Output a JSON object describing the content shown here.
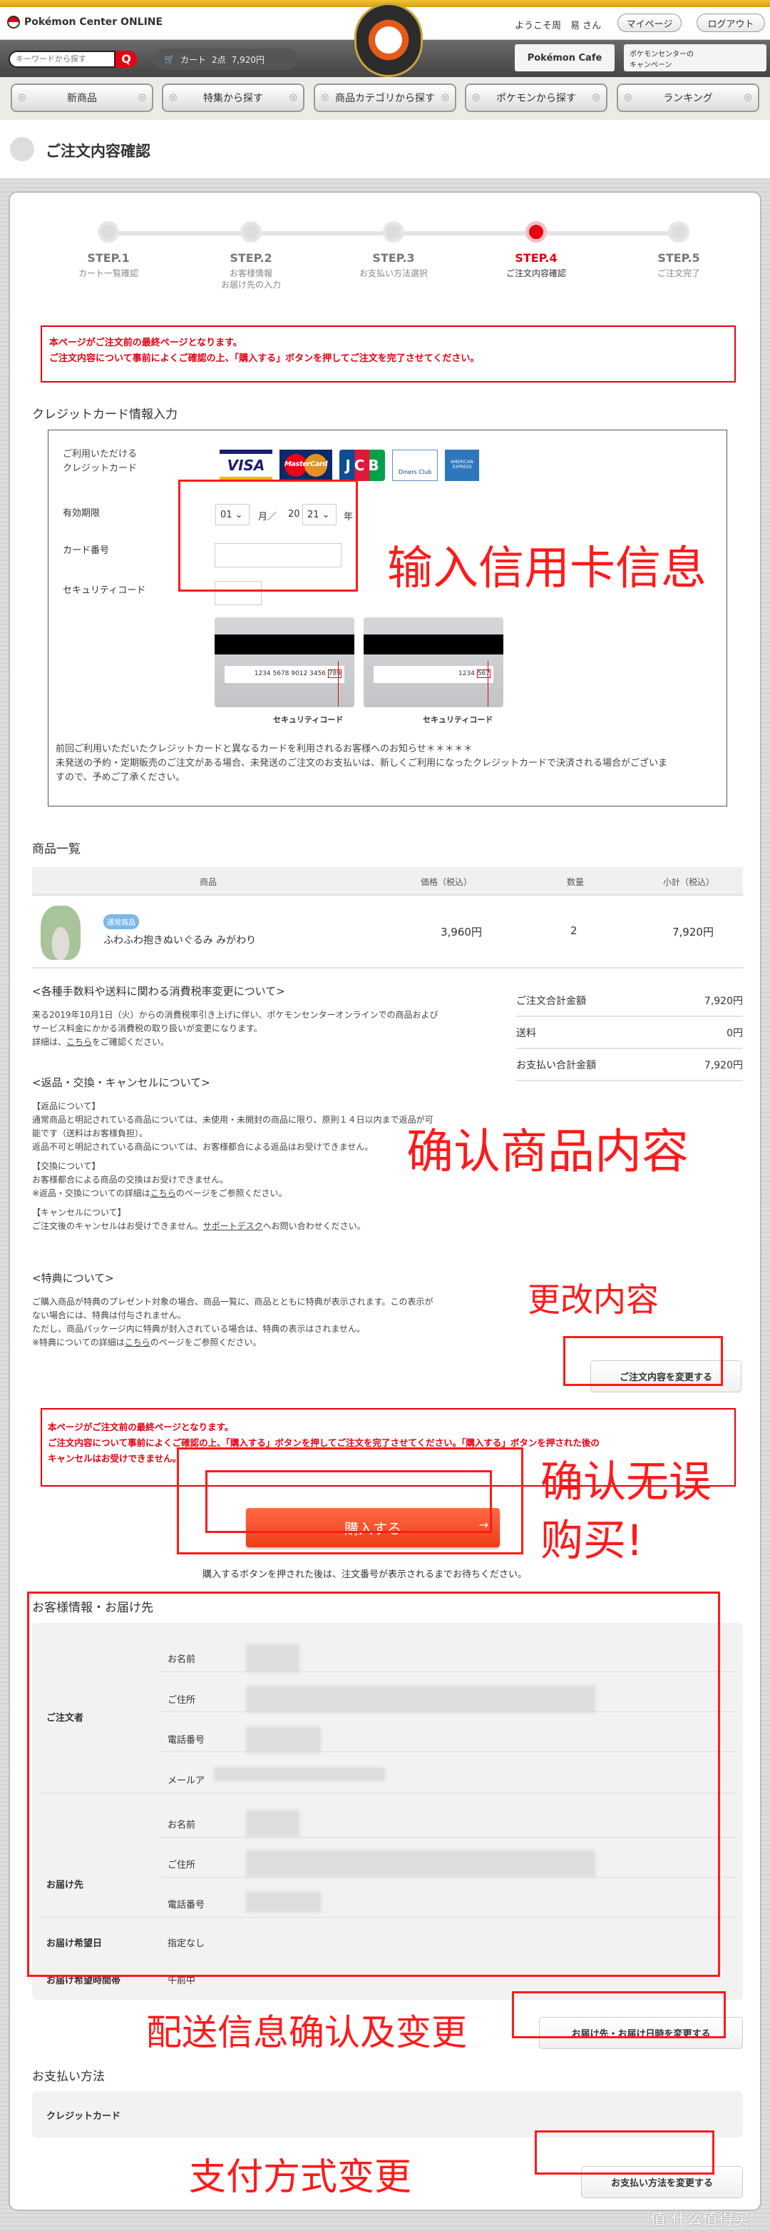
{
  "header": {
    "logo_text": "Pokémon Center ONLINE",
    "welcome": "ようこそ周　易 さん",
    "mypage": "マイページ",
    "logout": "ログアウト",
    "center_logo": "Pokémon Center ONLINE"
  },
  "search": {
    "placeholder": "キーワードから探す"
  },
  "cart": {
    "label": "カート",
    "count": "2点",
    "total": "7,920円"
  },
  "promo": {
    "cafe": "Pokémon Cafe",
    "campaign": "ポケモンセンターの\nキャンペーン"
  },
  "nav": [
    "新商品",
    "特集から探す",
    "商品カテゴリから探す",
    "ポケモンから探す",
    "ランキング"
  ],
  "page_title": "ご注文内容確認",
  "steps": [
    {
      "label": "STEP.1",
      "sub": "カート一覧確認"
    },
    {
      "label": "STEP.2",
      "sub": "お客様情報\nお届け先の入力"
    },
    {
      "label": "STEP.3",
      "sub": "お支払い方法選択"
    },
    {
      "label": "STEP.4",
      "sub": "ご注文内容確認"
    },
    {
      "label": "STEP.5",
      "sub": "ご注文完了"
    }
  ],
  "current_step": 4,
  "notice1": [
    "本ページがご注文前の最終ページとなります。",
    "ご注文内容について事前によくご確認の上、「購入する」ボタンを押してご注文を完了させてください。"
  ],
  "credit": {
    "heading": "クレジットカード情報入力",
    "accepted_label": "ご利用いただける\nクレジットカード",
    "brands": [
      "VISA",
      "MasterCard",
      "JCB",
      "Diners Club",
      "AMERICAN EXPRESS"
    ],
    "expiry_label": "有効期限",
    "month": "01",
    "month_unit": "月／",
    "year_prefix": "20",
    "year": "21",
    "year_unit": "年",
    "number_label": "カード番号",
    "cvv_label": "セキュリティコード",
    "sample1": "1234 5678 9012 3456",
    "sample1_code": "789",
    "sample2": "1234",
    "sample2_code": "567",
    "code_caption": "セキュリティコード",
    "notes": [
      "前回ご利用いただいたクレジットカードと異なるカードを利用されるお客様へのお知らせ＊＊＊＊＊",
      "未発送の予約・定期販売のご注文がある場合、未発送のご注文のお支払いは、新しくご利用になったクレジットカードで決済される場合がございますので、予めご了承ください。"
    ]
  },
  "products": {
    "heading": "商品一覧",
    "columns": [
      "商品",
      "価格（税込）",
      "数量",
      "小計（税込）"
    ],
    "items": [
      {
        "badge": "通常商品",
        "name": "ふわふわ抱きぬいぐるみ みがわり",
        "price": "3,960円",
        "qty": "2",
        "subtotal": "7,920円"
      }
    ]
  },
  "summary": [
    {
      "label": "ご注文合計金額",
      "value": "7,920円"
    },
    {
      "label": "送料",
      "value": "0円"
    },
    {
      "label": "お支払い合計金額",
      "value": "7,920円"
    }
  ],
  "tax": {
    "heading": "<各種手数料や送料に関わる消費税率変更について>",
    "lines": [
      "来る2019年10月1日（火）からの消費税率引き上げに伴い、ポケモンセンターオンラインでの商品および",
      "サービス料金にかかる消費税の取り扱いが変更になります。"
    ],
    "detail_pre": "詳細は、",
    "link": "こちら",
    "detail_post": "をご確認ください。"
  },
  "returns": {
    "heading": "<返品・交換・キャンセルについて>",
    "h_return": "【返品について】",
    "return_lines": [
      "通常商品と明記されている商品については、未使用・未開封の商品に限り、原則１４日以内まで返品が可",
      "能です（送料はお客様負担）。",
      "返品不可と明記されている商品については、お客様都合による返品はお受けできません。"
    ],
    "h_exchange": "【交換について】",
    "exchange_line": "お客様都合による商品の交換はお受けできません。",
    "exchange_pre": "※返品・交換についての詳細は",
    "exchange_link": "こちら",
    "exchange_post": "のページをご参照ください。",
    "h_cancel": "【キャンセルについて】",
    "cancel_pre": "ご注文後のキャンセルはお受けできません。",
    "cancel_link": "サポートデスク",
    "cancel_post": "へお問い合わせください。"
  },
  "bonus": {
    "heading": "<特典について>",
    "lines": [
      "ご購入商品が特典のプレゼント対象の場合、商品一覧に、商品とともに特典が表示されます。この表示が",
      "ない場合には、特典は付与されません。",
      "ただし、商品パッケージ内に特典が封入されている場合は、特典の表示はされません。"
    ],
    "pre": "※特典についての詳細は",
    "link": "こちら",
    "post": "のページをご参照ください。"
  },
  "change_order": "ご注文内容を変更する",
  "notice2": [
    "本ページがご注文前の最終ページとなります。",
    "ご注文内容について事前によくご確認の上、「購入する」ボタンを押してご注文を完了させてください。「購入する」ボタンを押された後の",
    "キャンセルはお受けできません。"
  ],
  "purchase": {
    "label": "購入する",
    "arrow": "→",
    "note": "購入するボタンを押された後は、注文番号が表示されるまでお待ちください。"
  },
  "customer": {
    "heading": "お客様情報・お届け先",
    "orderer": "ご注文者",
    "orderer_fields": [
      "お名前",
      "ご住所",
      "電話番号",
      "メールア"
    ],
    "ship": "お届け先",
    "ship_fields": [
      "お名前",
      "ご住所",
      "電話番号"
    ],
    "date_label": "お届け希望日",
    "date_value": "指定なし",
    "time_label": "お届け希望時間帯",
    "time_value": "午前中",
    "change": "お届け先・お届け日時を変更する"
  },
  "payment": {
    "heading": "お支払い方法",
    "method": "クレジットカード",
    "change": "お支払い方法を変更する"
  },
  "annotations": {
    "card": "输入信用卡信息",
    "products": "确认商品内容",
    "change": "更改内容",
    "buy1": "确认无误",
    "buy2": "购买!",
    "delivery": "配送信息确认及变更",
    "payment": "支付方式变更",
    "color": "#ff1a1a"
  },
  "watermark": "值 什么值得买",
  "colors": {
    "accent": "#e60012",
    "purchase": "#f04a24",
    "badge": "#7db8e8"
  }
}
